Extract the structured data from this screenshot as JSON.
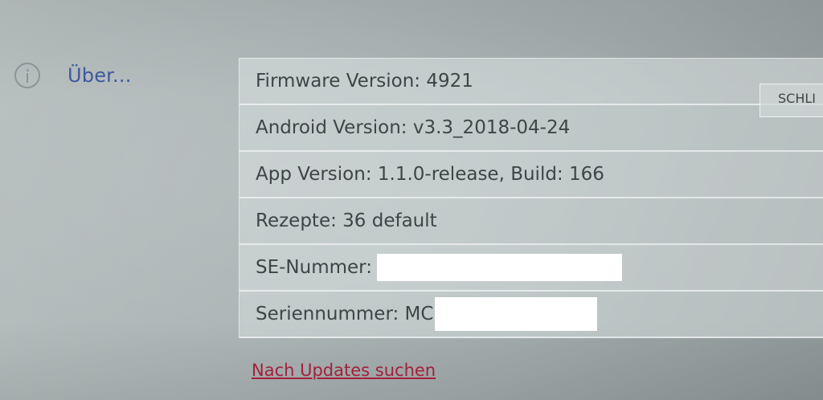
{
  "nav": {
    "about_label": "Über..."
  },
  "info": {
    "firmware": "Firmware Version: 4921",
    "android": "Android Version: v3.3_2018-04-24",
    "app": "App Version: 1.1.0-release, Build: 166",
    "recipes": "Rezepte: 36 default",
    "se_number_label": "SE-Nummer: ",
    "serial_label": "Seriennummer: MC"
  },
  "close_button": "SCHLI",
  "update_link": "Nach Updates suchen",
  "colors": {
    "accent_link": "#a3203c",
    "nav_label": "#3d5a9e"
  },
  "icons": {
    "about": "info-icon"
  }
}
